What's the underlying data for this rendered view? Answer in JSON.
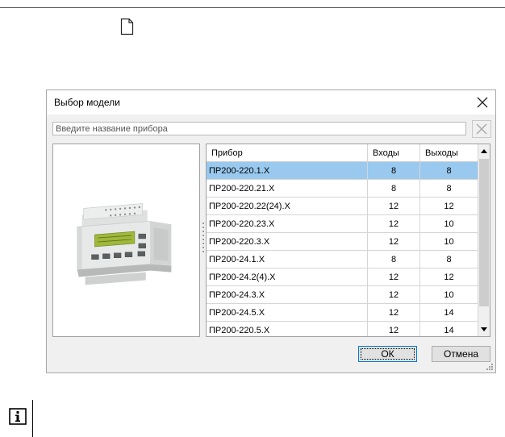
{
  "dialog": {
    "title": "Выбор модели",
    "search_placeholder": "Введите название прибора"
  },
  "table": {
    "columns": [
      "Прибор",
      "Входы",
      "Выходы"
    ],
    "rows": [
      {
        "name": "ПР200-220.1.Х",
        "inputs": "8",
        "outputs": "8",
        "selected": true
      },
      {
        "name": "ПР200-220.21.Х",
        "inputs": "8",
        "outputs": "8"
      },
      {
        "name": "ПР200-220.22(24).Х",
        "inputs": "12",
        "outputs": "12"
      },
      {
        "name": "ПР200-220.23.Х",
        "inputs": "12",
        "outputs": "10"
      },
      {
        "name": "ПР200-220.3.Х",
        "inputs": "12",
        "outputs": "10"
      },
      {
        "name": "ПР200-24.1.Х",
        "inputs": "8",
        "outputs": "8"
      },
      {
        "name": "ПР200-24.2(4).Х",
        "inputs": "12",
        "outputs": "12"
      },
      {
        "name": "ПР200-24.3.Х",
        "inputs": "12",
        "outputs": "10"
      },
      {
        "name": "ПР200-24.5.Х",
        "inputs": "12",
        "outputs": "14"
      },
      {
        "name": "ПР200-220.5.Х",
        "inputs": "12",
        "outputs": "14"
      }
    ]
  },
  "buttons": {
    "ok": "ОК",
    "cancel": "Отмена"
  },
  "icons": {
    "page": "document-icon",
    "close": "close-icon",
    "clear": "clear-search-icon",
    "info": "info-icon"
  },
  "colors": {
    "selection": "#99c9ef",
    "ok_border": "#0078d7",
    "lcd": "#9fb83a"
  }
}
